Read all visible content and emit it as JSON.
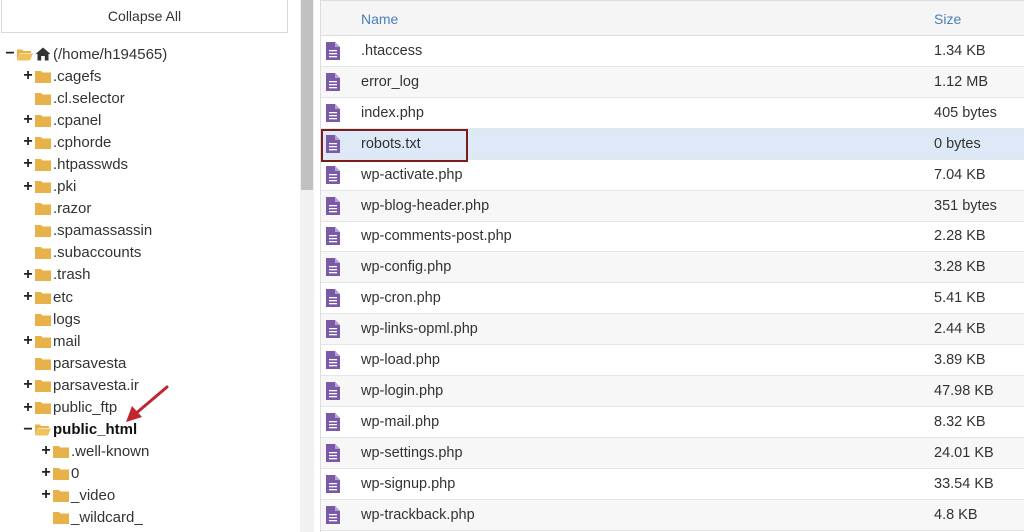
{
  "tree": {
    "collapse_label": "Collapse All",
    "root_label": "(/home/h194565)",
    "items": [
      {
        "label": ".cagefs",
        "toggle": "+",
        "bold": false
      },
      {
        "label": ".cl.selector",
        "toggle": "",
        "bold": false
      },
      {
        "label": ".cpanel",
        "toggle": "+",
        "bold": false
      },
      {
        "label": ".cphorde",
        "toggle": "+",
        "bold": false
      },
      {
        "label": ".htpasswds",
        "toggle": "+",
        "bold": false
      },
      {
        "label": ".pki",
        "toggle": "+",
        "bold": false
      },
      {
        "label": ".razor",
        "toggle": "",
        "bold": false
      },
      {
        "label": ".spamassassin",
        "toggle": "",
        "bold": false
      },
      {
        "label": ".subaccounts",
        "toggle": "",
        "bold": false
      },
      {
        "label": ".trash",
        "toggle": "+",
        "bold": false
      },
      {
        "label": "etc",
        "toggle": "+",
        "bold": false
      },
      {
        "label": "logs",
        "toggle": "",
        "bold": false
      },
      {
        "label": "mail",
        "toggle": "+",
        "bold": false
      },
      {
        "label": "parsavesta",
        "toggle": "",
        "bold": false
      },
      {
        "label": "parsavesta.ir",
        "toggle": "+",
        "bold": false
      },
      {
        "label": "public_ftp",
        "toggle": "+",
        "bold": false
      },
      {
        "label": "public_html",
        "toggle": "−",
        "bold": true
      }
    ],
    "children": [
      {
        "label": ".well-known",
        "toggle": "+"
      },
      {
        "label": "0",
        "toggle": "+"
      },
      {
        "label": "_video",
        "toggle": "+"
      },
      {
        "label": "_wildcard_",
        "toggle": ""
      }
    ]
  },
  "files": {
    "col_name": "Name",
    "col_size": "Size",
    "rows": [
      {
        "name": ".htaccess",
        "size": "1.34 KB"
      },
      {
        "name": "error_log",
        "size": "1.12 MB"
      },
      {
        "name": "index.php",
        "size": "405 bytes"
      },
      {
        "name": "robots.txt",
        "size": "0 bytes",
        "selected": true
      },
      {
        "name": "wp-activate.php",
        "size": "7.04 KB"
      },
      {
        "name": "wp-blog-header.php",
        "size": "351 bytes"
      },
      {
        "name": "wp-comments-post.php",
        "size": "2.28 KB"
      },
      {
        "name": "wp-config.php",
        "size": "3.28 KB"
      },
      {
        "name": "wp-cron.php",
        "size": "5.41 KB"
      },
      {
        "name": "wp-links-opml.php",
        "size": "2.44 KB"
      },
      {
        "name": "wp-load.php",
        "size": "3.89 KB"
      },
      {
        "name": "wp-login.php",
        "size": "47.98 KB"
      },
      {
        "name": "wp-mail.php",
        "size": "8.32 KB"
      },
      {
        "name": "wp-settings.php",
        "size": "24.01 KB"
      },
      {
        "name": "wp-signup.php",
        "size": "33.54 KB"
      },
      {
        "name": "wp-trackback.php",
        "size": "4.8 KB"
      }
    ]
  },
  "colors": {
    "folder": "#e8b24a",
    "file_icon": "#7a5aa6",
    "header_text": "#4a7fb8",
    "selected_row": "#dde9f7",
    "highlight_box": "#7b1c1c",
    "arrow": "#c0262b"
  },
  "icons": {
    "home": "home-icon",
    "folder": "folder-icon",
    "file": "file-icon",
    "arrow": "red-arrow-annotation"
  }
}
